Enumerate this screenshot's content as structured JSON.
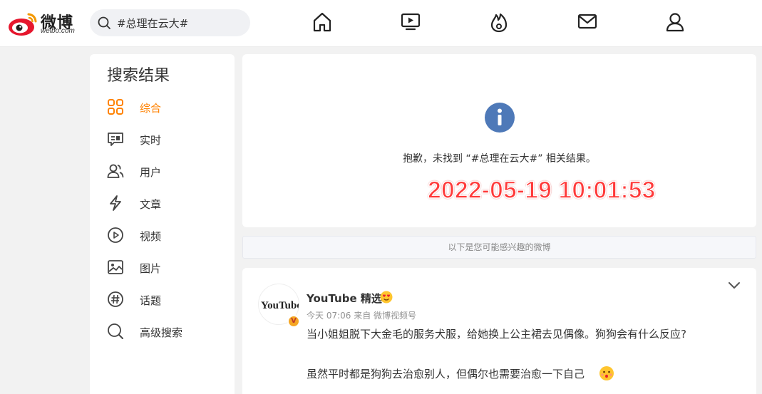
{
  "logo": {
    "text": "微博",
    "sub": "weibo.com"
  },
  "search": {
    "value": "#总理在云大#",
    "placeholder": ""
  },
  "nav": [
    "home-icon",
    "video-icon",
    "hot-icon",
    "mail-icon",
    "profile-icon"
  ],
  "sidebar": {
    "title": "搜索结果",
    "items": [
      {
        "label": "综合",
        "icon": "grid-icon",
        "active": true
      },
      {
        "label": "实时",
        "icon": "realtime-icon"
      },
      {
        "label": "用户",
        "icon": "users-icon"
      },
      {
        "label": "文章",
        "icon": "article-icon"
      },
      {
        "label": "视频",
        "icon": "play-icon"
      },
      {
        "label": "图片",
        "icon": "image-icon"
      },
      {
        "label": "话题",
        "icon": "hashtag-icon"
      },
      {
        "label": "高级搜索",
        "icon": "search-icon"
      }
    ]
  },
  "result": {
    "message": "抱歉，未找到 “#总理在云大#” 相关结果。",
    "timestamp_overlay": "2022-05-19 10:01:53"
  },
  "hint": "以下是您可能感兴趣的微博",
  "post": {
    "avatar_text": "YouTube",
    "author": "YouTube 精选",
    "meta": "今天 07:06  来自 微博视频号",
    "line1": "当小姐姐脱下大金毛的服务犬服，给她换上公主裙去见偶像。狗狗会有什么反应?",
    "line2": "虽然平时都是狗狗去治愈别人，但偶尔也需要治愈一下自己"
  },
  "colors": {
    "accent": "#ff8200",
    "info": "#4e79b8",
    "stamp": "#ff3a3a"
  }
}
